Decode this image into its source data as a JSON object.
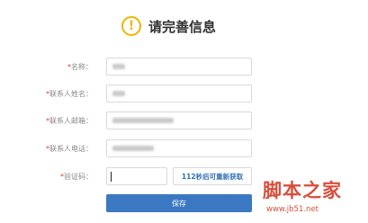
{
  "header": {
    "icon": "exclamation-circle-icon",
    "icon_glyph": "!",
    "title": "请完善信息"
  },
  "form": {
    "fields": [
      {
        "required_mark": "*",
        "label": "名称：",
        "value_state": "blurred"
      },
      {
        "required_mark": "*",
        "label": "联系人姓名：",
        "value_state": "blurred"
      },
      {
        "required_mark": "*",
        "label": "联系人邮箱：",
        "value_state": "blurred"
      },
      {
        "required_mark": "*",
        "label": "联系人电话：",
        "value_state": "blurred"
      }
    ],
    "captcha": {
      "required_mark": "*",
      "label": "验证码：",
      "value": "",
      "resend_label": "112秒后可重新获取"
    },
    "save_label": "保存"
  },
  "watermark": {
    "title": "脚本之家",
    "url": "www.jb51.net"
  },
  "colors": {
    "accent": "#3b78c2",
    "warning": "#f0b400",
    "required": "#e0403a",
    "link": "#2f6fb6",
    "watermark": "#d94e3c"
  }
}
